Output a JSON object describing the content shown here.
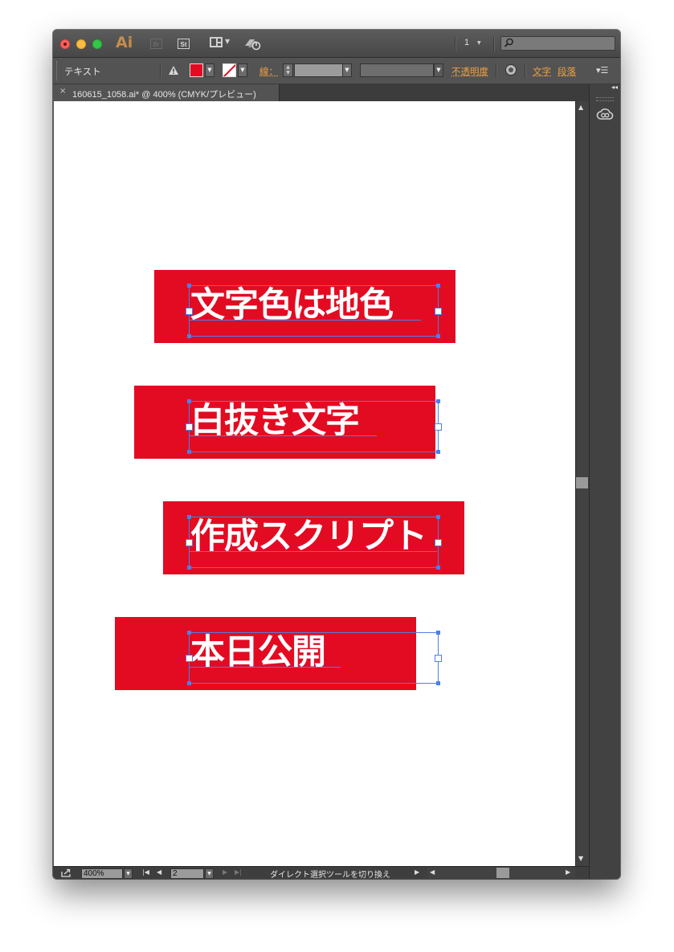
{
  "app": {
    "logo_text": "Ai",
    "bridge_label": "Br",
    "stock_label": "St",
    "page_indicator": "1",
    "search_placeholder": ""
  },
  "control_bar": {
    "selection_type": "テキスト",
    "stroke_label": "線：",
    "opacity_label": "不透明度",
    "character_label": "文字",
    "paragraph_label": "段落",
    "fill_color": "#e30b22"
  },
  "document_tab": {
    "close_glyph": "×",
    "title": "160615_1058.ai* @ 400% (CMYK/プレビュー)"
  },
  "artwork": {
    "color": "#e30b22",
    "text_color": "#ffffff",
    "items": [
      {
        "text": "文字色は地色"
      },
      {
        "text": "白抜き文字"
      },
      {
        "text": "作成スクリプト"
      },
      {
        "text": "本日公開"
      }
    ]
  },
  "status_bar": {
    "zoom": "400%",
    "artboard_number": "2",
    "message": "ダイレクト選択ツールを切り換え"
  }
}
